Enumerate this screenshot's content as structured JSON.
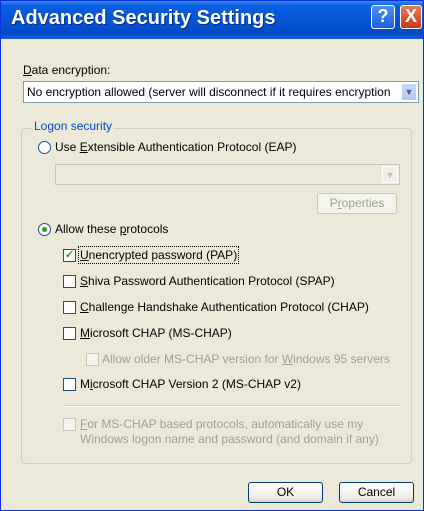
{
  "window": {
    "title": "Advanced Security Settings",
    "help_glyph": "?",
    "close_glyph": "X"
  },
  "encryption": {
    "label_prefix": "D",
    "label_rest": "ata encryption:",
    "value": "No encryption allowed (server will disconnect if it requires encryption"
  },
  "logon": {
    "legend": "Logon security",
    "eap": {
      "label_prefix": "Use ",
      "label_key": "E",
      "label_rest": "xtensible Authentication Protocol (EAP)",
      "selected": false
    },
    "eap_select_value": "",
    "properties_button": {
      "pre": "P",
      "key": "r",
      "rest": "operties"
    },
    "allow": {
      "label_pre": "Allow these ",
      "label_key": "p",
      "label_rest": "rotocols",
      "selected": true
    },
    "protocols": [
      {
        "key": "U",
        "rest": "nencrypted password (PAP)",
        "checked": true
      },
      {
        "key": "S",
        "rest": "hiva Password Authentication Protocol (SPAP)",
        "checked": false
      },
      {
        "key": "C",
        "rest": "hallenge Handshake Authentication Protocol (CHAP)",
        "checked": false
      },
      {
        "key": "M",
        "rest": "icrosoft CHAP (MS-CHAP)",
        "checked": false
      }
    ],
    "older_mschap": {
      "pre": "Allow older MS-CHAP version for ",
      "key": "W",
      "rest": "indows 95 servers",
      "checked": false
    },
    "mschap_v2": {
      "pre": "M",
      "key": "i",
      "rest": "crosoft CHAP Version 2 (MS-CHAP v2)",
      "checked": false
    },
    "auto_logon": {
      "line1_key": "F",
      "line1_rest": "or MS-CHAP based protocols, automatically use my",
      "line2": "Windows logon name and password (and domain if any)",
      "checked": false
    }
  },
  "buttons": {
    "ok": "OK",
    "cancel": "Cancel"
  },
  "icons": {
    "dropdown": "▼",
    "check": "✓"
  }
}
